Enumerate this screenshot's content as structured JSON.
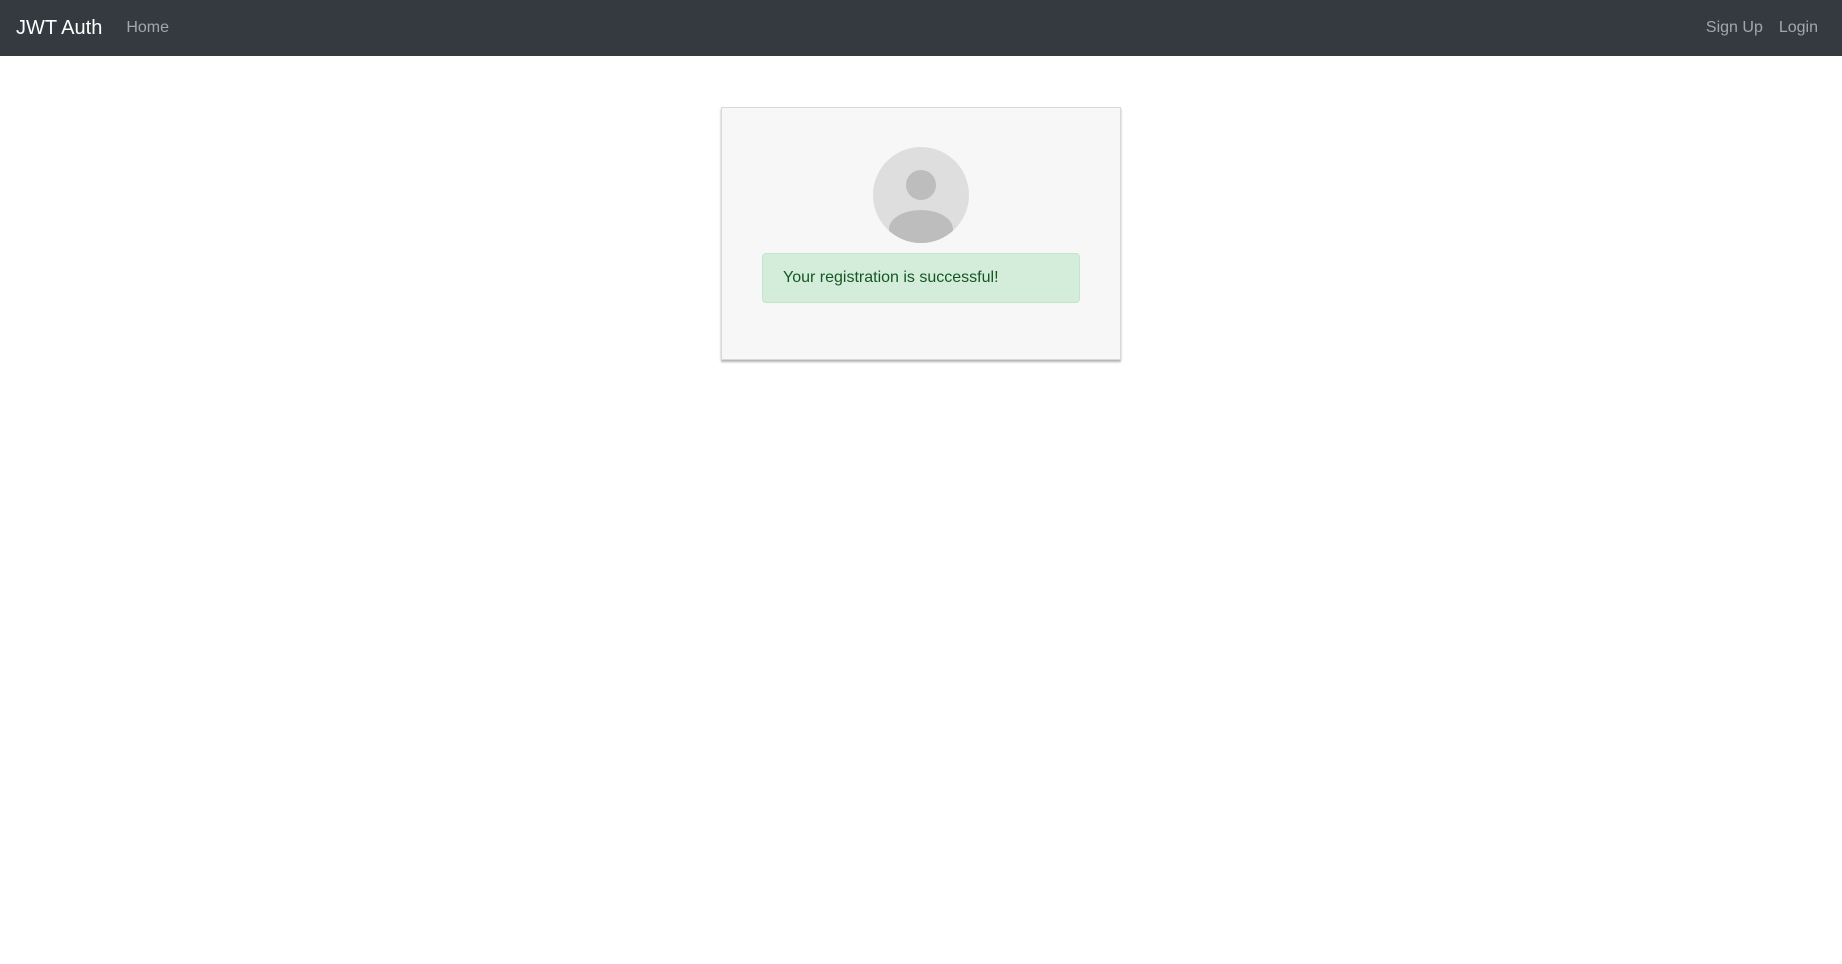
{
  "navbar": {
    "brand": "JWT Auth",
    "home_label": "Home",
    "signup_label": "Sign Up",
    "login_label": "Login",
    "background_color": "#343a40"
  },
  "card": {
    "avatar_icon": "user-avatar-icon",
    "alert_message": "Your registration is successful!",
    "alert_background": "#d4edda",
    "alert_text_color": "#155724"
  }
}
